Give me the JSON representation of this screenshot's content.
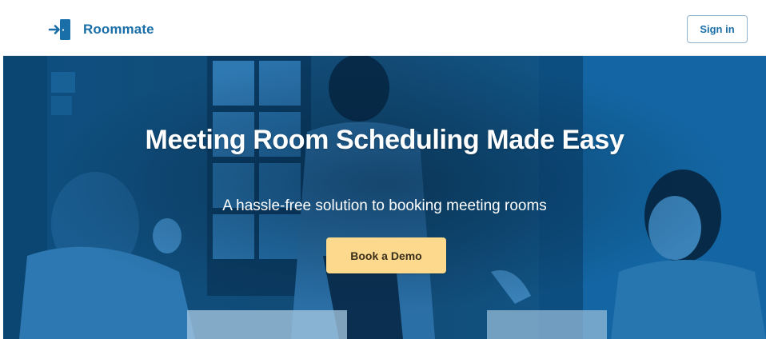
{
  "header": {
    "brand_name": "Roommate",
    "logo_icon": "door-enter-icon",
    "signin_label": "Sign in"
  },
  "hero": {
    "headline": "Meeting Room Scheduling Made Easy",
    "subheadline": "A hassle-free solution to booking meeting rooms",
    "cta_label": "Book a Demo",
    "photo_description_icon": "meeting-photo"
  },
  "colors": {
    "brand": "#1b6fa8",
    "hero_overlay": "#0f5a8f",
    "cta": "#fcd98c"
  }
}
